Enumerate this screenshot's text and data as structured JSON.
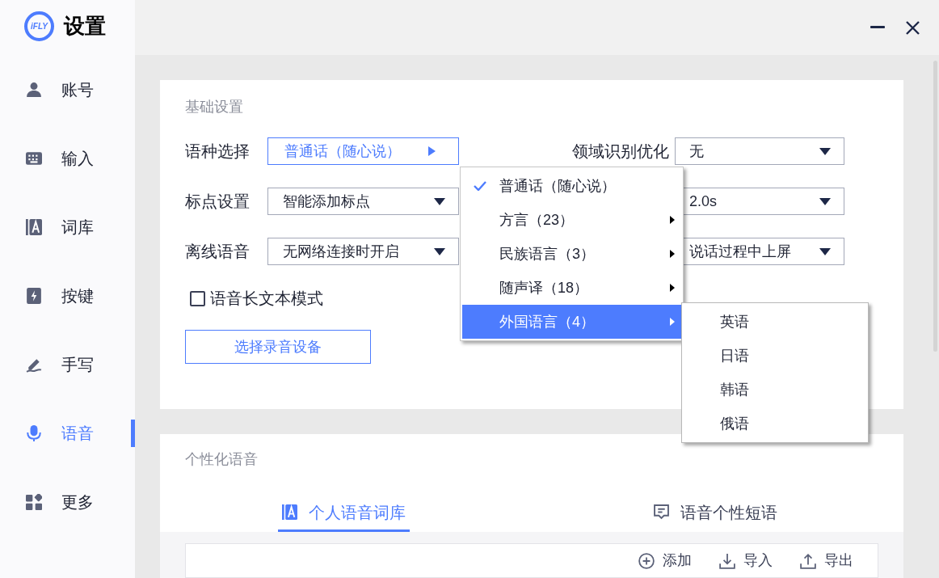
{
  "sidebar": {
    "logo_text": "iFLY",
    "title": "设置",
    "items": [
      {
        "label": "账号",
        "kind": "person",
        "selected": false
      },
      {
        "label": "输入",
        "kind": "keyboard",
        "selected": false
      },
      {
        "label": "词库",
        "kind": "book",
        "selected": false
      },
      {
        "label": "按键",
        "kind": "bolt",
        "selected": false
      },
      {
        "label": "手写",
        "kind": "pen",
        "selected": false
      },
      {
        "label": "语音",
        "kind": "mic",
        "selected": true
      },
      {
        "label": "更多",
        "kind": "grid",
        "selected": false
      }
    ]
  },
  "basic_settings": {
    "title": "基础设置",
    "left_rows": [
      {
        "label": "语种选择",
        "value": "普通话（随心说）",
        "open": true
      },
      {
        "label": "标点设置",
        "value": "智能添加标点",
        "open": false
      },
      {
        "label": "离线语音",
        "value": "无网络连接时开启",
        "open": false
      }
    ],
    "right_rows": [
      {
        "label": "领域识别优化",
        "value": "无"
      },
      {
        "value": "2.0s"
      },
      {
        "value": "说话过程中上屏"
      }
    ],
    "checkbox": {
      "label": "语音长文本模式",
      "checked": false
    },
    "button": "选择录音设备"
  },
  "language_menu": {
    "items": [
      {
        "label": "普通话（随心说）",
        "checked": true,
        "has_submenu": false,
        "selected": false
      },
      {
        "label": "方言（23）",
        "checked": false,
        "has_submenu": true,
        "selected": false
      },
      {
        "label": "民族语言（3）",
        "checked": false,
        "has_submenu": true,
        "selected": false
      },
      {
        "label": "随声译（18）",
        "checked": false,
        "has_submenu": true,
        "selected": false
      },
      {
        "label": "外国语言（4）",
        "checked": false,
        "has_submenu": true,
        "selected": true
      }
    ],
    "submenu": [
      "英语",
      "日语",
      "韩语",
      "俄语"
    ]
  },
  "personal_voice": {
    "title": "个性化语音",
    "tabs": [
      {
        "label": "个人语音词库",
        "kind": "book",
        "selected": true
      },
      {
        "label": "语音个性短语",
        "kind": "message",
        "selected": false
      }
    ],
    "actions": [
      {
        "label": "添加",
        "kind": "plus"
      },
      {
        "label": "导入",
        "kind": "import"
      },
      {
        "label": "导出",
        "kind": "export"
      }
    ]
  }
}
